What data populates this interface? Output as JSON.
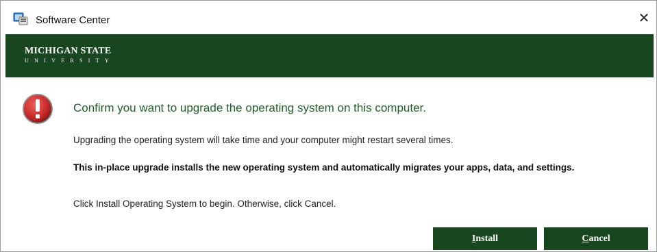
{
  "window": {
    "title": "Software Center",
    "close_glyph": "✕"
  },
  "banner": {
    "logo_line1": "MICHIGAN STATE",
    "logo_line2": "UNIVERSITY",
    "color": "#18471f"
  },
  "dialog": {
    "icon": "error-icon",
    "headline": "Confirm you want to upgrade the operating system on this computer.",
    "paragraph1": "Upgrading the operating system will take time and your computer might restart several times.",
    "paragraph2": "This in-place upgrade installs the new operating system and automatically migrates your apps, data, and settings.",
    "paragraph3": "Click Install Operating System to begin. Otherwise, click Cancel."
  },
  "buttons": {
    "install": {
      "mnemonic": "I",
      "rest": "nstall"
    },
    "cancel": {
      "mnemonic": "C",
      "rest": "ancel"
    }
  },
  "colors": {
    "accent_green": "#18471f",
    "headline_green": "#1f5f2a",
    "error_red": "#c62828"
  }
}
